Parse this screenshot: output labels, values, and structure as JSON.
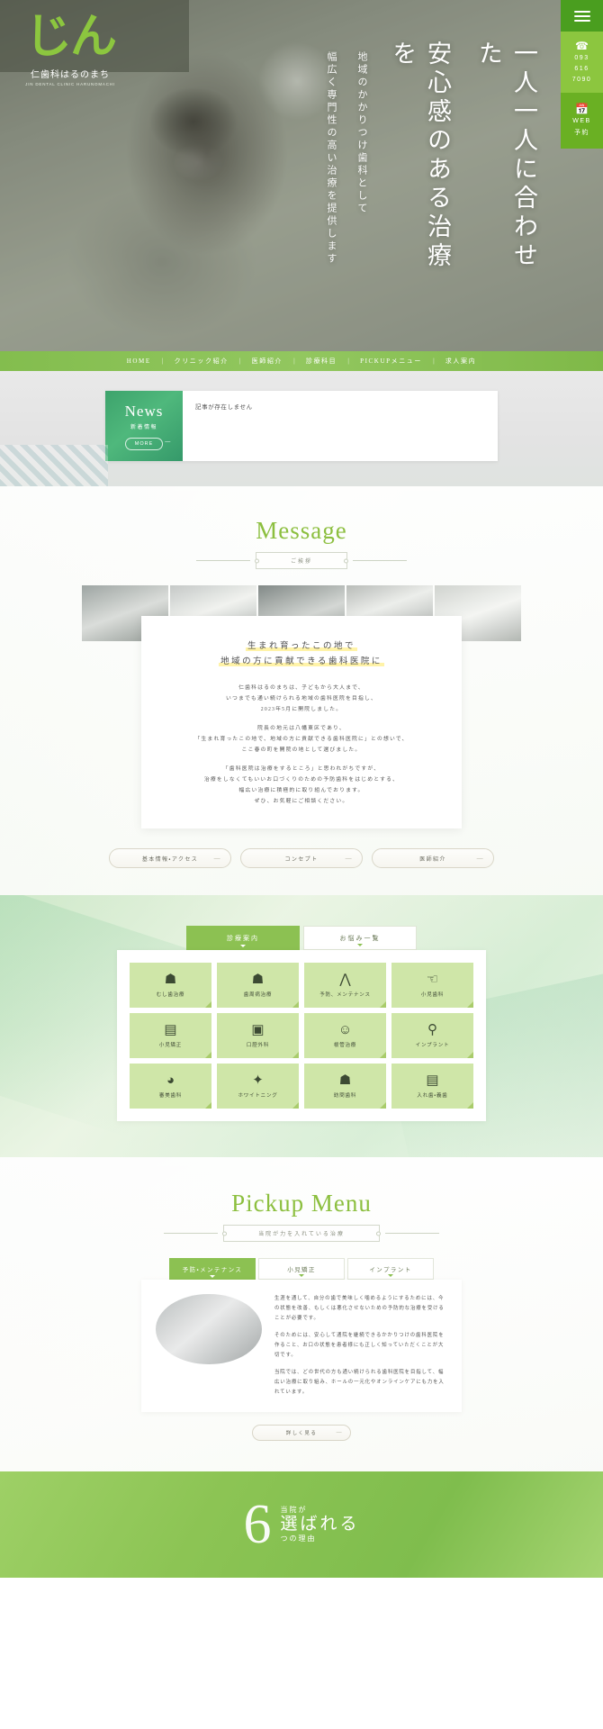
{
  "brand": {
    "logo_mark": "じん",
    "name": "仁歯科はるのまち",
    "roman": "JIN DENTAL CLINIC HARUNOMACHI"
  },
  "side_nav": {
    "menu_icon": "hamburger-icon",
    "phone_icon": "phone-icon",
    "phone": "093 616 7090",
    "phone_l1": "093",
    "phone_l2": "616",
    "phone_l3": "7090",
    "calendar_icon": "calendar-icon",
    "web_l1": "WEB",
    "web_l2": "予約"
  },
  "hero": {
    "headline": "一人一人に合わせた",
    "headline2": "安心感のある治療を",
    "sub1": "地域のかかりつけ歯科として",
    "sub2": "幅広く専門性の高い治療を提供します"
  },
  "nav": {
    "items": [
      {
        "label": "HOME"
      },
      {
        "label": "クリニック紹介"
      },
      {
        "label": "医師紹介"
      },
      {
        "label": "診療科目"
      },
      {
        "label": "PICKUPメニュー"
      },
      {
        "label": "求人案内"
      }
    ],
    "separator": "|"
  },
  "news": {
    "title": "News",
    "subtitle": "新着情報",
    "more": "MORE",
    "empty": "記事が存在しません"
  },
  "message": {
    "title": "Message",
    "subtitle": "ご挨拶",
    "headline_1": "生まれ育ったこの地で",
    "headline_2": "地域の方に貢献できる歯科医院に",
    "body": [
      "仁歯科はるのまちは、子どもから大人まで、",
      "いつまでも通い続けられる地域の歯科医院を目指し、",
      "2023年5月に開院しました。",
      "院長の地元は八幡東区であり、",
      "「生まれ育ったこの地で、地域の方に貢献できる歯科医院に」との想いで、",
      "ここ春の町を開院の地として選びました。",
      "「歯科医院は治療をするところ」と思われがちですが、",
      "治療をしなくてもいいお口づくりのための予防歯科をはじめとする、",
      "幅広い治療に積極的に取り組んでおります。",
      "ぜひ、お気軽にご相談ください。"
    ],
    "buttons": [
      {
        "label": "基本情報・アクセス"
      },
      {
        "label": "コンセプト"
      },
      {
        "label": "医師紹介"
      }
    ]
  },
  "treatment": {
    "tabs": [
      {
        "label": "診療案内",
        "active": true
      },
      {
        "label": "お悩み一覧",
        "active": false
      }
    ],
    "items": [
      {
        "label": "むし歯治療",
        "icon": "tooth-icon",
        "glyph": "🦷"
      },
      {
        "label": "歯周病治療",
        "icon": "gum-tooth-icon",
        "glyph": "🦷"
      },
      {
        "label": "予防、メンテナンス",
        "icon": "dental-tools-icon",
        "glyph": "⚒"
      },
      {
        "label": "小児歯科",
        "icon": "child-tooth-icon",
        "glyph": "🪥"
      },
      {
        "label": "小児矯正",
        "icon": "braces-icon",
        "glyph": "⚙"
      },
      {
        "label": "口腔外科",
        "icon": "denture-icon",
        "glyph": "🦷"
      },
      {
        "label": "根管治療",
        "icon": "root-canal-icon",
        "glyph": "🪥"
      },
      {
        "label": "インプラント",
        "icon": "implant-icon",
        "glyph": "🔩"
      },
      {
        "label": "審美歯科",
        "icon": "smile-icon",
        "glyph": "☺"
      },
      {
        "label": "ホワイトニング",
        "icon": "whitening-tooth-icon",
        "glyph": "✦"
      },
      {
        "label": "訪問歯科",
        "icon": "house-icon",
        "glyph": "🏠"
      },
      {
        "label": "入れ歯・義歯",
        "icon": "full-denture-icon",
        "glyph": "⌒"
      }
    ]
  },
  "pickup": {
    "title": "Pickup Menu",
    "subtitle": "当院が力を入れている治療",
    "tabs": [
      {
        "label": "予防・メンテナンス",
        "active": true
      },
      {
        "label": "小児矯正",
        "active": false
      },
      {
        "label": "インプラント",
        "active": false
      }
    ],
    "body": [
      "生涯を通して、自分の歯で美味しく噛めるようにするためには、今の状態を改善、もしくは悪化させないための予防的な治療を受けることが必要です。",
      "そのためには、安心して通院を継続できるかかりつけの歯科医院を作ること、お口の状態を患者様にも正しく知っていただくことが大切です。",
      "当院では、どの世代の方も通い続けられる歯科医院を目指して、幅広い治療に取り組み、ホールの一元化やオンラインケアにも力を入れています。"
    ],
    "more": "詳しく見る",
    "image": "dental-chair-photo"
  },
  "reason": {
    "number": "6",
    "line1": "当院が",
    "line2": "選ばれる",
    "line3": "つの理由"
  },
  "colors": {
    "brand_green": "#8cc63f",
    "nav_green": "#8cc152",
    "dark_green": "#4a9e1f",
    "news_green": "#3da36c",
    "cell_green": "#cfe6a8",
    "highlight_yellow": "#fff3a8"
  }
}
